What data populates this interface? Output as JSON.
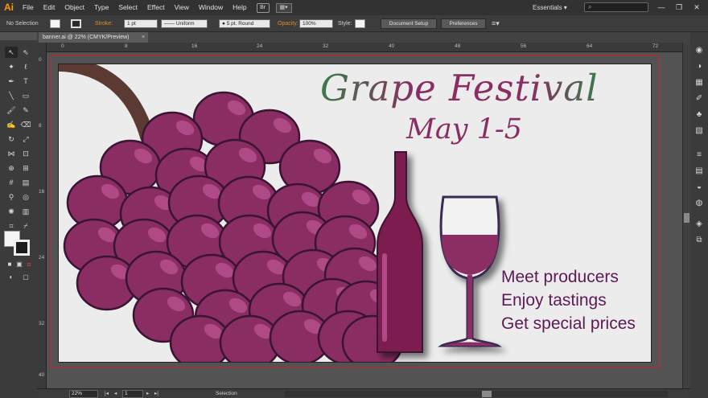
{
  "app": {
    "logo": "Ai",
    "workspace": "Essentials",
    "workspace_arrow": "▾",
    "search_icon": "⌕"
  },
  "menu": [
    "File",
    "Edit",
    "Object",
    "Type",
    "Select",
    "Effect",
    "View",
    "Window",
    "Help"
  ],
  "bridge_label": "Br",
  "window_controls": {
    "minimize": "—",
    "maximize": "❐",
    "close": "✕"
  },
  "control_bar": {
    "selection": "No Selection",
    "stroke_label": "Stroke:",
    "stroke_weight": "1 pt",
    "brush_profile": "Uniform",
    "brush": "5 pt. Round",
    "opacity_label": "Opacity:",
    "opacity_value": "100%",
    "style_label": "Style:",
    "document_setup": "Document Setup",
    "preferences": "Preferences"
  },
  "document_tab": {
    "title": "banner.ai @ 22% (CMYK/Preview)",
    "close": "×"
  },
  "ruler_top_ticks": [
    "0",
    "8",
    "16",
    "24",
    "32",
    "40",
    "48",
    "56",
    "64",
    "72"
  ],
  "ruler_left_ticks": [
    "0",
    "8",
    "16",
    "24",
    "32",
    "40"
  ],
  "artboard": {
    "title": "Grape Festival",
    "date": "May 1-5",
    "list": [
      "Meet producers",
      "Enjoy tastings",
      "Get special prices"
    ],
    "colors": {
      "grape": "#8a2d63",
      "grape_highlight": "#b04a86",
      "grape_outline": "#3a1433",
      "stem": "#5a3a32",
      "bottle": "#7c1a4f",
      "title_start": "#3c7a4a",
      "title_end": "#8a2d63",
      "list_text": "#5e1a55",
      "bleed": "#c1272d"
    }
  },
  "status_bar": {
    "zoom": "22%",
    "artboard_number": "1",
    "tool_status": "Selection"
  }
}
